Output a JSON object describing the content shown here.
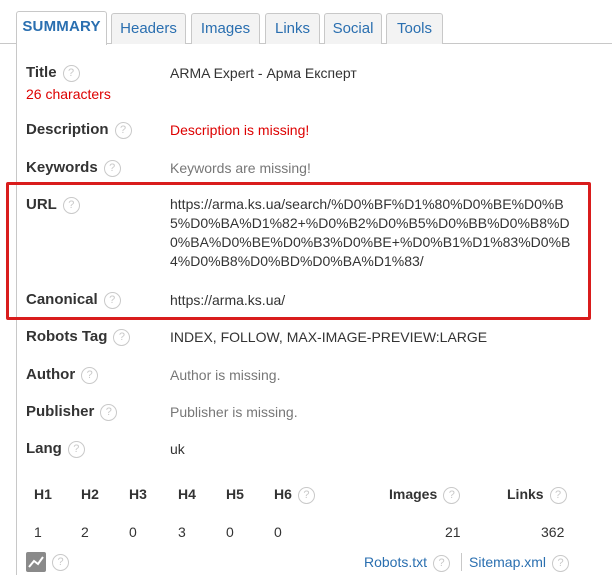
{
  "tabs": [
    {
      "label": "SUMMARY"
    },
    {
      "label": "Headers"
    },
    {
      "label": "Images"
    },
    {
      "label": "Links"
    },
    {
      "label": "Social"
    },
    {
      "label": "Tools"
    }
  ],
  "summary": {
    "title": {
      "label": "Title",
      "value": "ARMA Expert - Арма Експерт",
      "sub": "26 characters"
    },
    "description": {
      "label": "Description",
      "value": "Description is missing!"
    },
    "keywords": {
      "label": "Keywords",
      "value": "Keywords are missing!"
    },
    "url": {
      "label": "URL",
      "value": "https://arma.ks.ua/search/%D0%BF%D1%80%D0%BE%D0%B5%D0%BA%D1%82+%D0%B2%D0%B5%D0%BB%D0%B8%D0%BA%D0%BE%D0%B3%D0%BE+%D0%B1%D1%83%D0%B4%D0%B8%D0%BD%D0%BA%D1%83/"
    },
    "canonical": {
      "label": "Canonical",
      "value": "https://arma.ks.ua/"
    },
    "robots": {
      "label": "Robots Tag",
      "value": "INDEX, FOLLOW, MAX-IMAGE-PREVIEW:LARGE"
    },
    "author": {
      "label": "Author",
      "value": "Author is missing."
    },
    "publisher": {
      "label": "Publisher",
      "value": "Publisher is missing."
    },
    "lang": {
      "label": "Lang",
      "value": "uk"
    }
  },
  "stats": {
    "headers": [
      "H1",
      "H2",
      "H3",
      "H4",
      "H5",
      "H6"
    ],
    "counts": [
      "1",
      "2",
      "0",
      "3",
      "0",
      "0"
    ],
    "images_label": "Images",
    "images_count": "21",
    "links_label": "Links",
    "links_count": "362"
  },
  "footer": {
    "robots_link": "Robots.txt",
    "sitemap_link": "Sitemap.xml"
  },
  "help_glyph": "?",
  "colors": {
    "accent": "#2a6fb0",
    "error": "#dd0000",
    "highlight": "#d91c1c",
    "muted": "#777777"
  }
}
